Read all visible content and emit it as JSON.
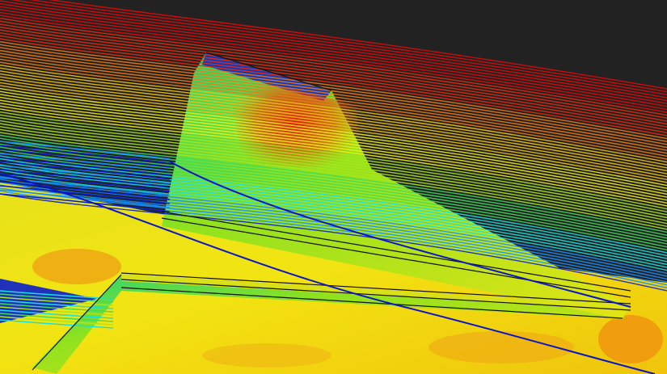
{
  "scene": {
    "background": "#222222",
    "colormap": [
      "#0a1ecc",
      "#1590ff",
      "#17e0e0",
      "#3ddc5a",
      "#a6e81a",
      "#f2ee12",
      "#f2c20c",
      "#f07a10",
      "#e82a08",
      "#e00a08"
    ],
    "surface_base_color": "#f0dc12",
    "edge_color": "#111111"
  }
}
